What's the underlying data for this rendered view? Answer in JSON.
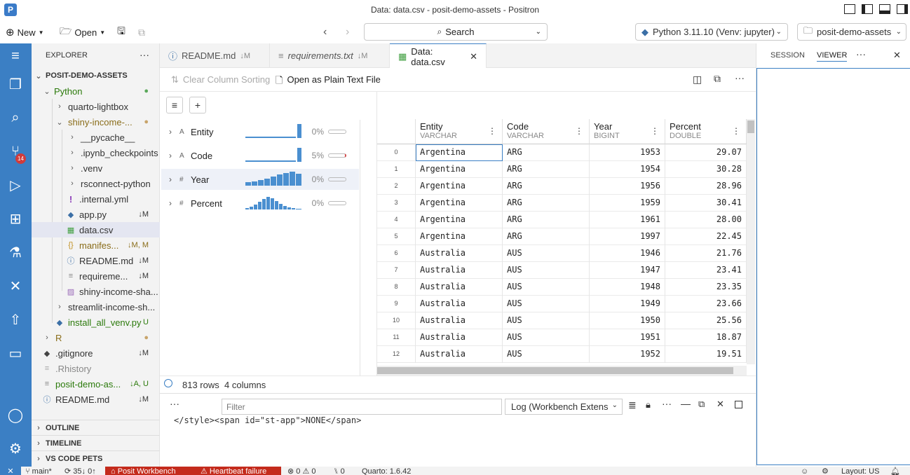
{
  "window": {
    "title": "Data: data.csv - posit-demo-assets - Positron"
  },
  "toolbar": {
    "new_label": "New",
    "open_label": "Open",
    "search_label": "Search",
    "interpreter_label": "Python 3.11.10 (Venv: jupyter)",
    "folder_label": "posit-demo-assets"
  },
  "activity": {
    "scm_badge": "14"
  },
  "explorer": {
    "header": "EXPLORER",
    "root": "POSIT-DEMO-ASSETS",
    "items": [
      {
        "label": "Python",
        "badge": ""
      },
      {
        "label": "quarto-lightbox",
        "badge": ""
      },
      {
        "label": "shiny-income-...",
        "badge": ""
      },
      {
        "label": "__pycache__",
        "badge": ""
      },
      {
        "label": ".ipynb_checkpoints",
        "badge": ""
      },
      {
        "label": ".venv",
        "badge": ""
      },
      {
        "label": "rsconnect-python",
        "badge": ""
      },
      {
        "label": ".internal.yml",
        "badge": ""
      },
      {
        "label": "app.py",
        "badge": "↓M"
      },
      {
        "label": "data.csv",
        "badge": ""
      },
      {
        "label": "manifes...",
        "badge": "↓M, M"
      },
      {
        "label": "README.md",
        "badge": "↓M"
      },
      {
        "label": "requireme...",
        "badge": "↓M"
      },
      {
        "label": "shiny-income-sha...",
        "badge": ""
      },
      {
        "label": "streamlit-income-sh...",
        "badge": ""
      },
      {
        "label": "install_all_venv.py",
        "badge": "U"
      },
      {
        "label": "R",
        "badge": ""
      },
      {
        "label": ".gitignore",
        "badge": "↓M"
      },
      {
        "label": ".Rhistory",
        "badge": ""
      },
      {
        "label": "posit-demo-as...",
        "badge": "↓A, U"
      },
      {
        "label": "README.md",
        "badge": "↓M"
      }
    ],
    "sections": [
      "OUTLINE",
      "TIMELINE",
      "VS CODE PETS"
    ]
  },
  "tabs": [
    {
      "label": "README.md",
      "badge": "↓M"
    },
    {
      "label": "requirements.txt",
      "badge": "↓M"
    },
    {
      "label": "Data: data.csv",
      "badge": ""
    }
  ],
  "dataviewer": {
    "clear_sort_label": "Clear Column Sorting",
    "plain_text_label": "Open as Plain Text File",
    "columns_summary": [
      {
        "type": "A",
        "name": "Entity",
        "missing": "0%"
      },
      {
        "type": "A",
        "name": "Code",
        "missing": "5%"
      },
      {
        "type": "#",
        "name": "Year",
        "missing": "0%"
      },
      {
        "type": "#",
        "name": "Percent",
        "missing": "0%"
      }
    ],
    "headers": [
      {
        "name": "Entity",
        "type": "VARCHAR"
      },
      {
        "name": "Code",
        "type": "VARCHAR"
      },
      {
        "name": "Year",
        "type": "BIGINT"
      },
      {
        "name": "Percent",
        "type": "DOUBLE"
      }
    ],
    "rows": [
      [
        "0",
        "Argentina",
        "ARG",
        "1953",
        "29.07"
      ],
      [
        "1",
        "Argentina",
        "ARG",
        "1954",
        "30.28"
      ],
      [
        "2",
        "Argentina",
        "ARG",
        "1956",
        "28.96"
      ],
      [
        "3",
        "Argentina",
        "ARG",
        "1959",
        "30.41"
      ],
      [
        "4",
        "Argentina",
        "ARG",
        "1961",
        "28.00"
      ],
      [
        "5",
        "Argentina",
        "ARG",
        "1997",
        "22.45"
      ],
      [
        "6",
        "Australia",
        "AUS",
        "1946",
        "21.76"
      ],
      [
        "7",
        "Australia",
        "AUS",
        "1947",
        "23.41"
      ],
      [
        "8",
        "Australia",
        "AUS",
        "1948",
        "23.35"
      ],
      [
        "9",
        "Australia",
        "AUS",
        "1949",
        "23.66"
      ],
      [
        "10",
        "Australia",
        "AUS",
        "1950",
        "25.56"
      ],
      [
        "11",
        "Australia",
        "AUS",
        "1951",
        "18.87"
      ],
      [
        "12",
        "Australia",
        "AUS",
        "1952",
        "19.51"
      ]
    ],
    "rows_count": "813 rows",
    "cols_count": "4 columns"
  },
  "panel": {
    "filter_placeholder": "Filter",
    "log_selected": "Log (Workbench Extens",
    "log_line": "</style><span id=\"st-app\">NONE</span>"
  },
  "rightpanel": {
    "session_tab": "SESSION",
    "viewer_tab": "VIEWER"
  },
  "statusbar": {
    "branch": "main*",
    "sync": "35↓ 0↑",
    "workbench": "Posit Workbench",
    "heartbeat": "Heartbeat failure",
    "problems": "⊗ 0 ⚠ 0",
    "ports": "0",
    "quarto": "Quarto: 1.6.42",
    "layout": "Layout: US"
  },
  "colors": {
    "accent": "#3b7fc4",
    "git_green": "#2b7a0b",
    "warning_red": "#c42b1c"
  }
}
